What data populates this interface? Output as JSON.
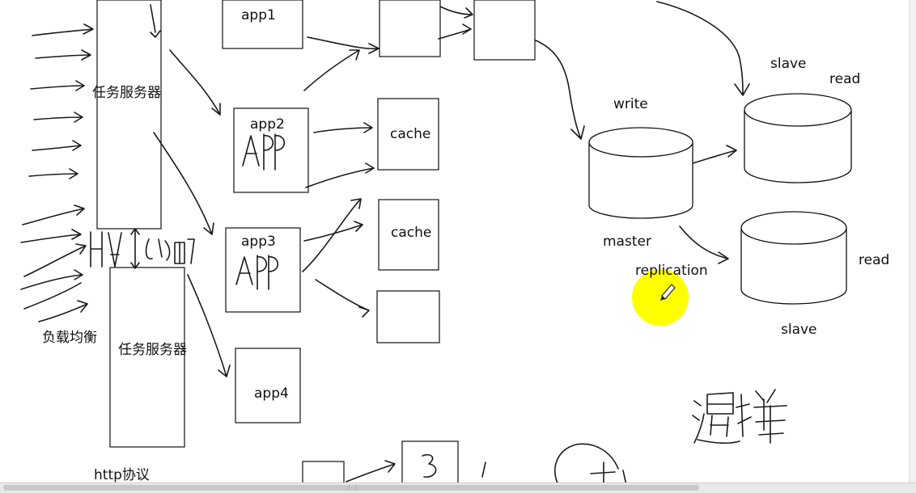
{
  "labels": {
    "app1": "app1",
    "app2": "app2",
    "app3": "app3",
    "app4": "app4",
    "server_top": "任务服务器",
    "server_bottom": "任务服务器",
    "load_balance": "负载均衡",
    "http": "http协议",
    "cache1": "cache",
    "cache2": "cache",
    "write": "write",
    "master": "master",
    "replication": "replication",
    "slave_top": "slave",
    "read_top": "read",
    "slave_bottom": "slave",
    "read_bottom": "read"
  },
  "colors": {
    "ink": "#111111",
    "highlight": "#ffff00",
    "background": "#ffffff"
  },
  "icons": {
    "cursor": "pencil-icon"
  }
}
